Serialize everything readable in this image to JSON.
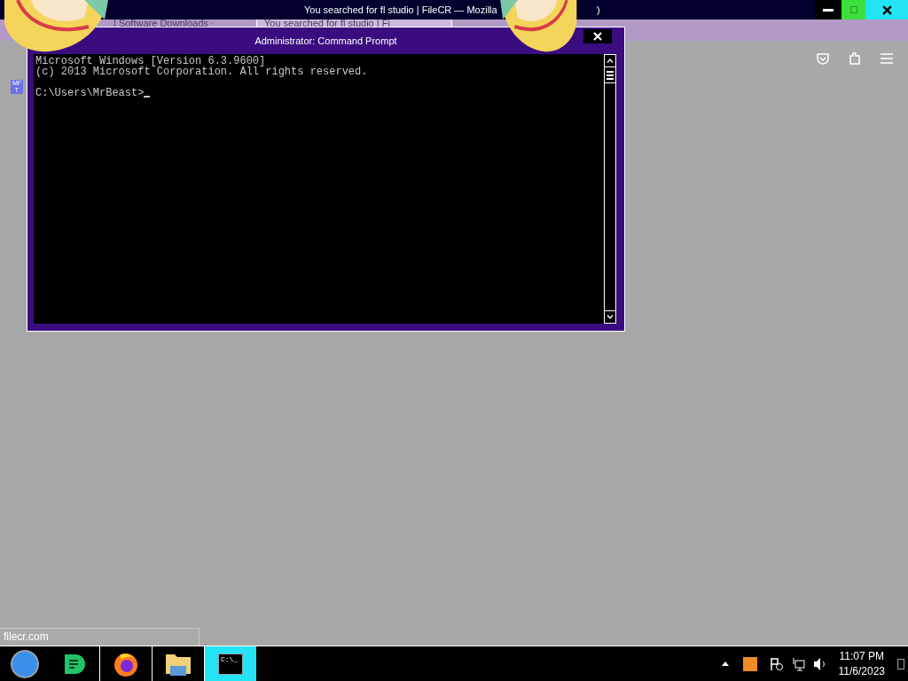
{
  "browser": {
    "title": "You searched for fl studio | FileCR — Mozilla",
    "title_end": ")",
    "tabs": [
      {
        "label": "| Software Downloads ·",
        "selected": false
      },
      {
        "label": "You searched for fl studio | Fi",
        "selected": true
      }
    ],
    "sidebar_badge": "MF T",
    "status": "filecr.com"
  },
  "console": {
    "title": "Administrator: Command Prompt",
    "lines": [
      "Microsoft Windows [Version 6.3.9600]",
      "(c) 2013 Microsoft Corporation. All rights reserved."
    ],
    "prompt": "C:\\Users\\MrBeast>"
  },
  "taskbar": {
    "apps": [
      {
        "kind": "chat",
        "selected": false
      },
      {
        "kind": "firefox",
        "selected": false
      },
      {
        "kind": "folder",
        "selected": false
      },
      {
        "kind": "terminal",
        "selected": true,
        "label": "C:\\_"
      }
    ],
    "time": "11:07 PM",
    "date": "11/6/2023"
  }
}
